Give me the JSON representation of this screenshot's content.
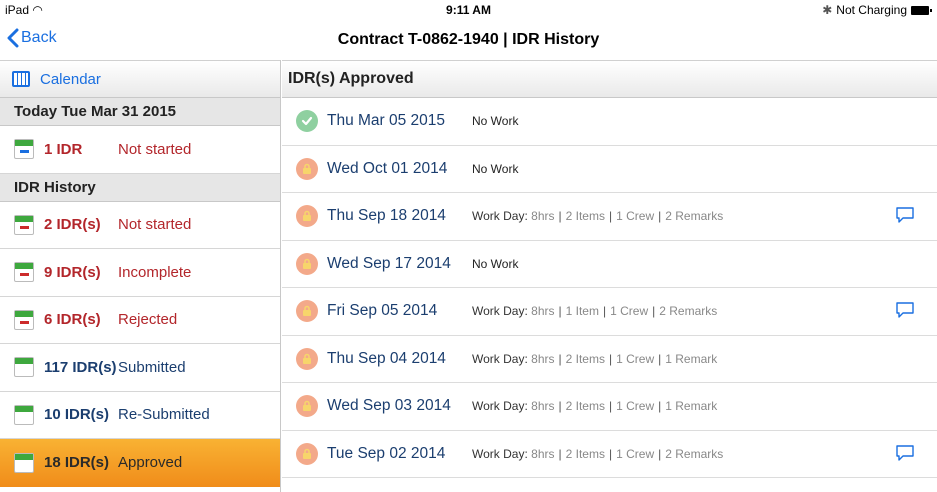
{
  "statusbar": {
    "device": "iPad",
    "time": "9:11 AM",
    "charging": "Not Charging"
  },
  "navbar": {
    "back_label": "Back",
    "title": "Contract T-0862-1940 | IDR History"
  },
  "left": {
    "calendar_label": "Calendar",
    "today_header": "Today Tue Mar 31 2015",
    "today_row": {
      "count": "1 IDR",
      "status": "Not started"
    },
    "history_header": "IDR History",
    "history_rows": [
      {
        "count": "2 IDR(s)",
        "status": "Not started"
      },
      {
        "count": "9 IDR(s)",
        "status": "Incomplete"
      },
      {
        "count": "6 IDR(s)",
        "status": "Rejected"
      },
      {
        "count": "117 IDR(s)",
        "status": "Submitted"
      },
      {
        "count": "10 IDR(s)",
        "status": "Re-Submitted"
      },
      {
        "count": "18 IDR(s)",
        "status": "Approved"
      }
    ]
  },
  "right": {
    "header": "IDR(s) Approved",
    "rows": [
      {
        "date": "Thu Mar 05 2015",
        "no_work": "No Work"
      },
      {
        "date": "Wed Oct 01 2014",
        "no_work": "No Work"
      },
      {
        "date": "Thu Sep 18 2014",
        "label": "Work Day:",
        "hrs": "8hrs",
        "items": "2 Items",
        "crew": "1 Crew",
        "remarks": "2 Remarks"
      },
      {
        "date": "Wed Sep 17 2014",
        "no_work": "No Work"
      },
      {
        "date": "Fri Sep 05 2014",
        "label": "Work Day:",
        "hrs": "8hrs",
        "items": "1 Item",
        "crew": "1 Crew",
        "remarks": "2 Remarks"
      },
      {
        "date": "Thu Sep 04 2014",
        "label": "Work Day:",
        "hrs": "8hrs",
        "items": "2 Items",
        "crew": "1 Crew",
        "remarks": "1 Remark"
      },
      {
        "date": "Wed Sep 03 2014",
        "label": "Work Day:",
        "hrs": "8hrs",
        "items": "2 Items",
        "crew": "1 Crew",
        "remarks": "1 Remark"
      },
      {
        "date": "Tue Sep 02 2014",
        "label": "Work Day:",
        "hrs": "8hrs",
        "items": "2 Items",
        "crew": "1 Crew",
        "remarks": "2 Remarks"
      }
    ]
  },
  "colors": {
    "accent": "#1a6fe0",
    "selected": "#f5a12a",
    "red_status": "#b3262b",
    "blue_status": "#1b3e6f"
  }
}
